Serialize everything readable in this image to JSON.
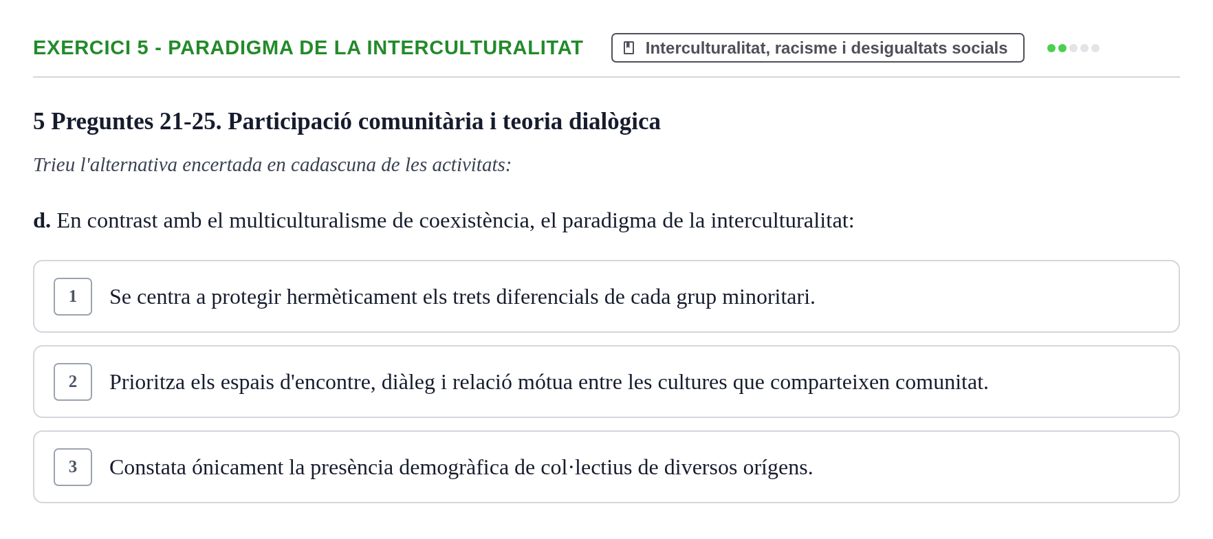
{
  "header": {
    "title": "EXERCICI 5 - PARADIGMA DE LA INTERCULTURALITAT",
    "topic": "Interculturalitat, racisme i desigualtats socials",
    "progress": [
      {
        "done": true
      },
      {
        "done": true
      },
      {
        "done": false
      },
      {
        "done": false
      },
      {
        "done": false
      }
    ]
  },
  "section": {
    "heading": "5 Preguntes 21-25. Participació comunitària i teoria dialògica",
    "instruction": "Trieu l'alternativa encertada en cadascuna de les activitats:"
  },
  "question": {
    "text": "**d.** En contrast amb el multiculturalisme de coexistència, el paradigma de la interculturalitat:"
  },
  "options": [
    {
      "number": "1",
      "text": "Se centra a protegir hermèticament els trets diferencials de cada grup minoritari.",
      "selected": false
    },
    {
      "number": "2",
      "text": "Prioritza els espais d'encontre, diàleg i relació mótua entre les cultures que comparteixen comunitat.",
      "selected": false
    },
    {
      "number": "3",
      "text": "Constata ónicament la presència demogràfica de col·lectius de diversos orígens.",
      "selected": false
    }
  ]
}
